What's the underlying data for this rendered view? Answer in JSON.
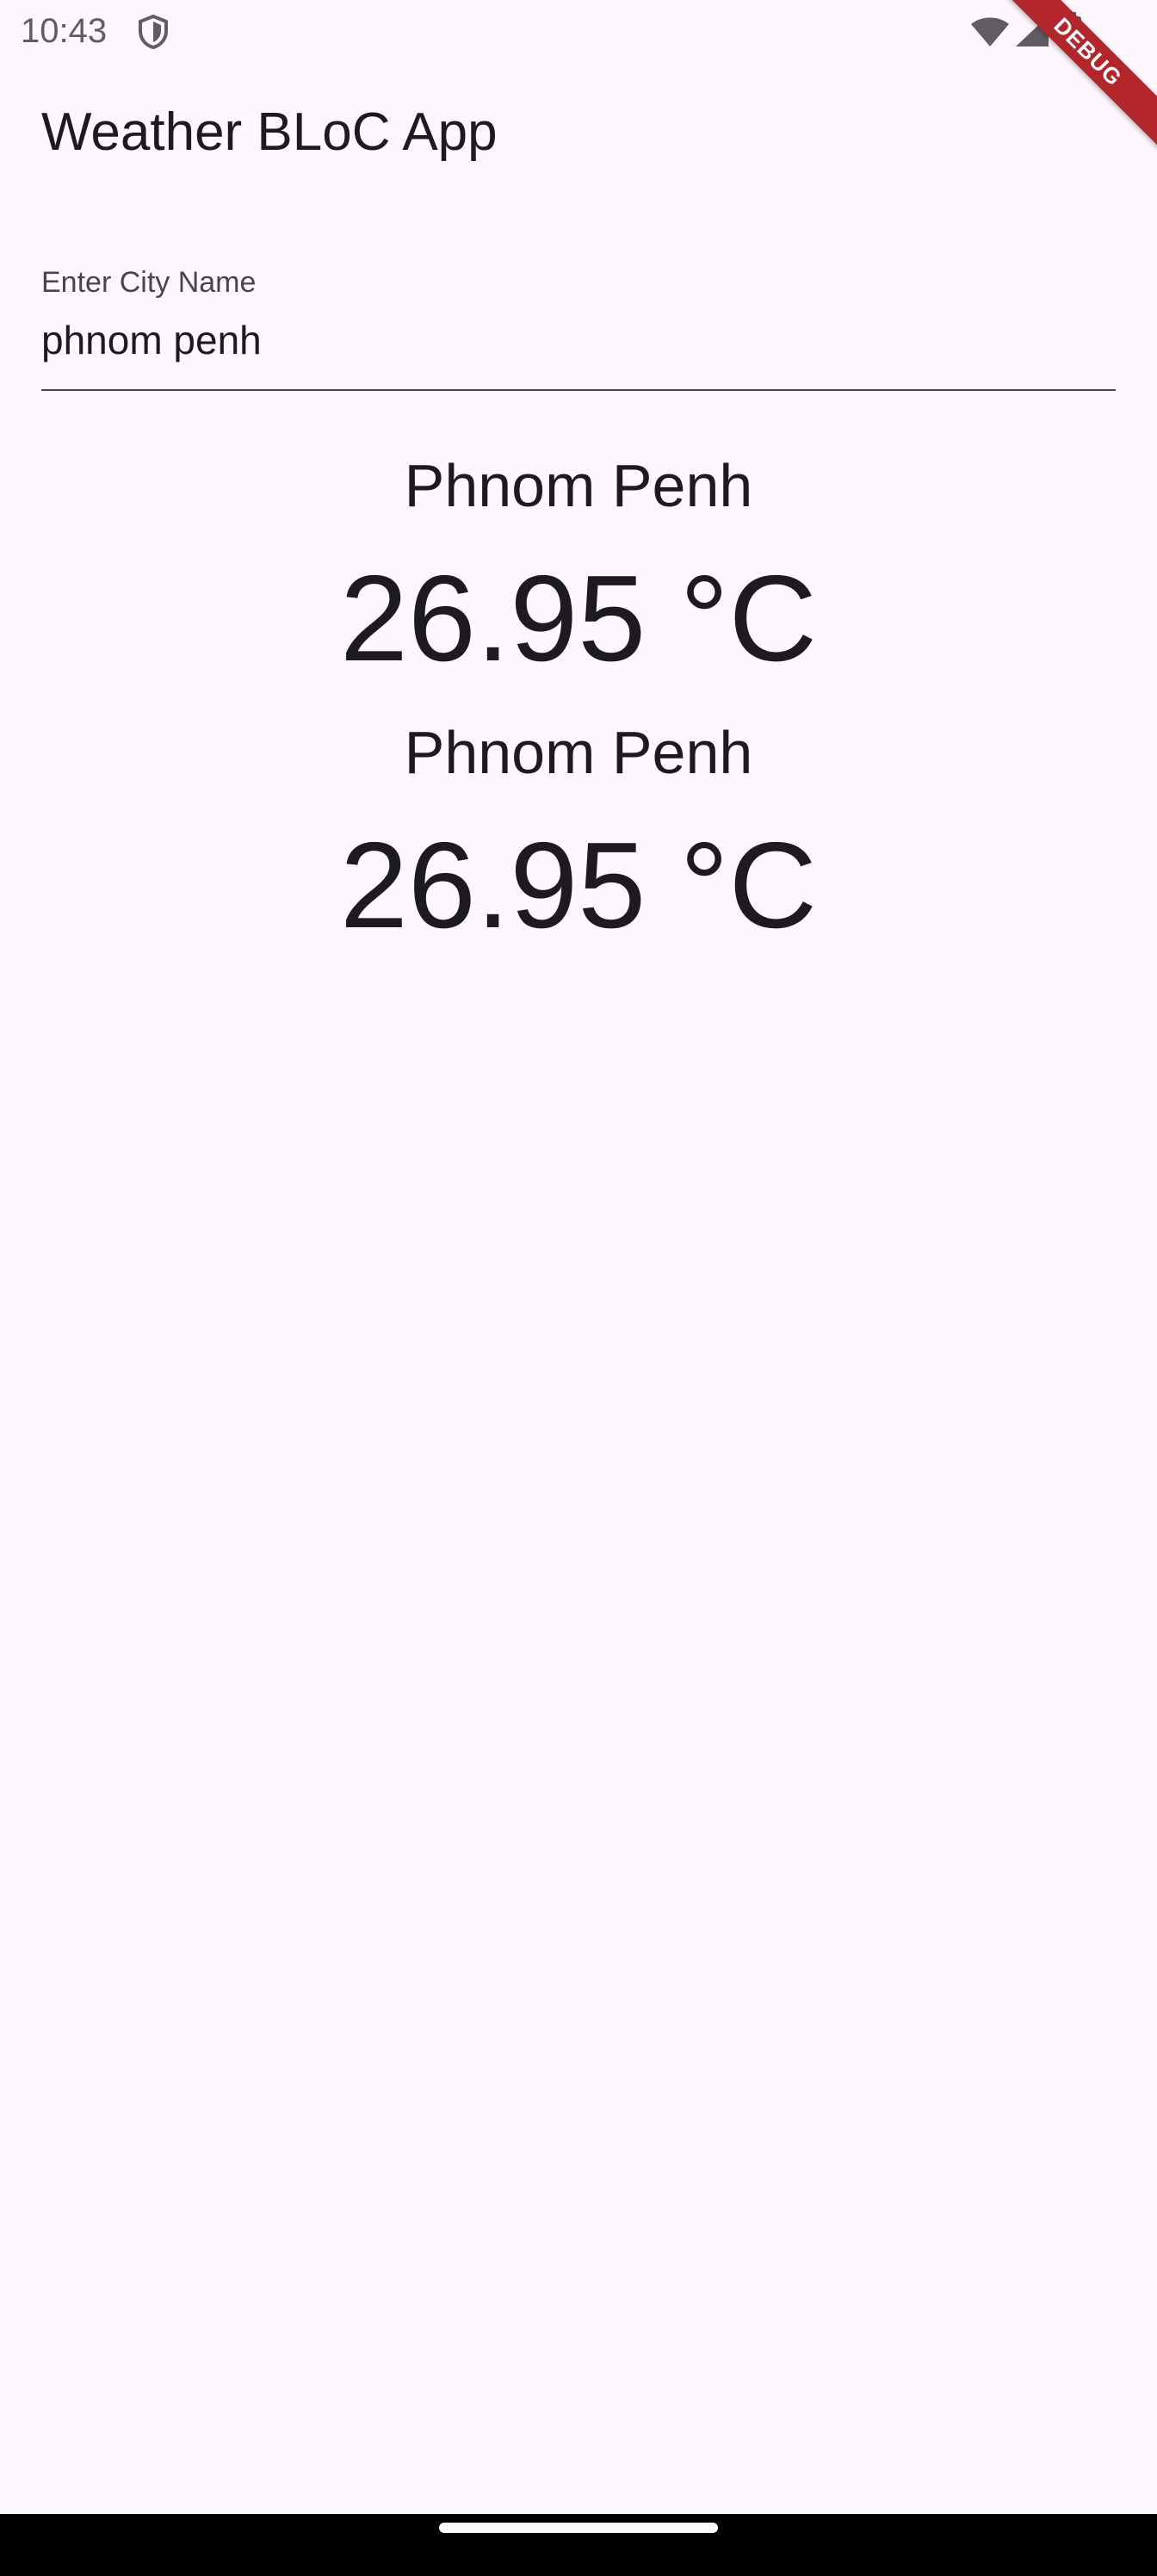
{
  "status_bar": {
    "time": "10:43",
    "icons": [
      "shield-icon",
      "wifi-icon",
      "signal-icon",
      "battery-icon"
    ]
  },
  "debug_banner": "DEBUG",
  "app_bar": {
    "title": "Weather BLoC App"
  },
  "city_field": {
    "label": "Enter City Name",
    "value": "phnom penh"
  },
  "results": [
    {
      "city": "Phnom Penh",
      "temperature": "26.95 °C"
    },
    {
      "city": "Phnom Penh",
      "temperature": "26.95 °C"
    }
  ],
  "colors": {
    "background": "#fdf7ff",
    "text": "#1d1b20",
    "debug_banner": "#b3262b"
  }
}
